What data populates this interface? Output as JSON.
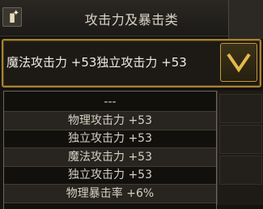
{
  "header": {
    "title": "攻击力及暴击类",
    "icon": "book-sparkle-icon"
  },
  "combo": {
    "selected": "魔法攻击力 +53独立攻击力 +53",
    "icon": "chevron-down-icon"
  },
  "dropdown": {
    "options": [
      {
        "label": "---"
      },
      {
        "label": "物理攻击力 +53"
      },
      {
        "label": "独立攻击力 +53"
      },
      {
        "label": "魔法攻击力 +53"
      },
      {
        "label": "独立攻击力 +53"
      },
      {
        "label": "物理暴击率 +6%"
      }
    ]
  },
  "colors": {
    "accent": "#c09a3b",
    "frame": "#a8842f",
    "text": "#d4d0c4"
  }
}
